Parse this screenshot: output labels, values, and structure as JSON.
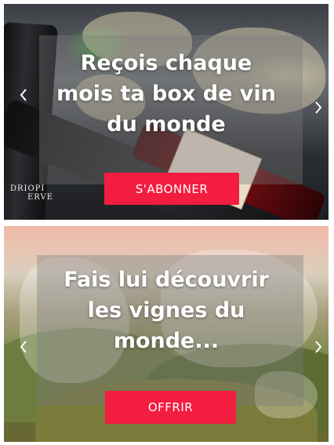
{
  "banners": [
    {
      "headline_lines": [
        "Reçois chaque",
        "mois ta box de vin",
        "du monde"
      ],
      "button_label": "S'ABONNER",
      "bottle_label_text": [
        "DRIOPI",
        "ERVE"
      ]
    },
    {
      "headline_lines": [
        "Fais lui découvrir",
        "les vignes du",
        "monde..."
      ],
      "button_label": "OFFRIR"
    }
  ],
  "icons": {
    "prev": "chevron-left-icon",
    "next": "chevron-right-icon"
  },
  "colors": {
    "cta_background": "#f21d3f",
    "cta_text": "#ffffff",
    "headline_text": "#ffffff"
  }
}
